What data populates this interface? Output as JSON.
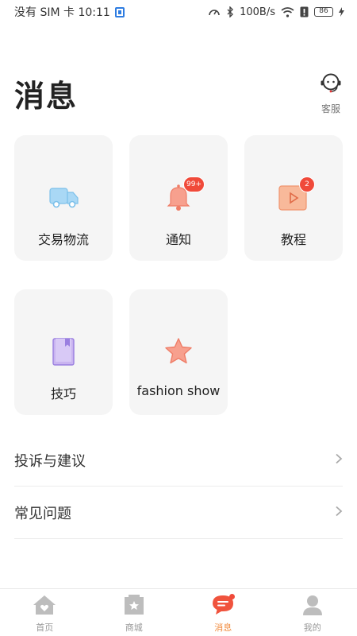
{
  "status_bar": {
    "carrier": "没有 SIM 卡 10:11",
    "net_speed": "100B/s",
    "battery": "86"
  },
  "header": {
    "title": "消息",
    "service_label": "客服"
  },
  "cards": [
    {
      "label": "交易物流",
      "icon": "truck-icon"
    },
    {
      "label": "通知",
      "icon": "bell-icon",
      "badge": "99+"
    },
    {
      "label": "教程",
      "icon": "video-icon",
      "badge": "2"
    },
    {
      "label": "技巧",
      "icon": "book-icon"
    },
    {
      "label": "fashion show",
      "icon": "star-icon"
    }
  ],
  "list": [
    {
      "label": "投诉与建议"
    },
    {
      "label": "常见问题"
    }
  ],
  "bottom_nav": [
    {
      "label": "首页",
      "icon": "home-icon"
    },
    {
      "label": "商城",
      "icon": "shop-icon"
    },
    {
      "label": "消息",
      "icon": "message-icon",
      "active": true
    },
    {
      "label": "我的",
      "icon": "profile-icon"
    }
  ],
  "colors": {
    "accent": "#f08a3c",
    "badge": "#f04a3a",
    "card_bg": "#f5f5f5"
  }
}
